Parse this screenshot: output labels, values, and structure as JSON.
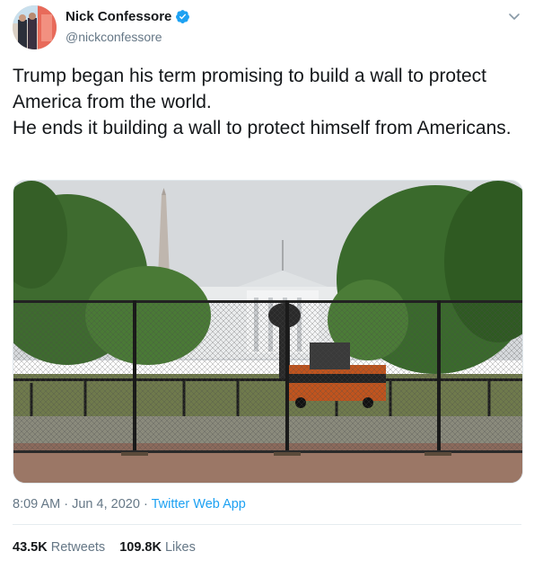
{
  "author": {
    "name": "Nick Confessore",
    "handle": "@nickconfessore",
    "verified": true,
    "verified_color": "#1da1f2"
  },
  "tweet": {
    "lines": [
      "Trump began his term promising to build a wall to protect America from the world.",
      "He ends it building a wall to protect himself from Americans."
    ]
  },
  "meta": {
    "time": "8:09 AM",
    "separator": "·",
    "date": "Jun 4, 2020",
    "app": "Twitter Web App"
  },
  "stats": {
    "retweets_count": "43.5K",
    "retweets_label": "Retweets",
    "likes_count": "109.8K",
    "likes_label": "Likes"
  },
  "icons": {
    "verified": "verified-badge-icon",
    "menu": "chevron-down-icon"
  },
  "colors": {
    "text": "#14171a",
    "secondary": "#657786",
    "link": "#1da1f2"
  }
}
